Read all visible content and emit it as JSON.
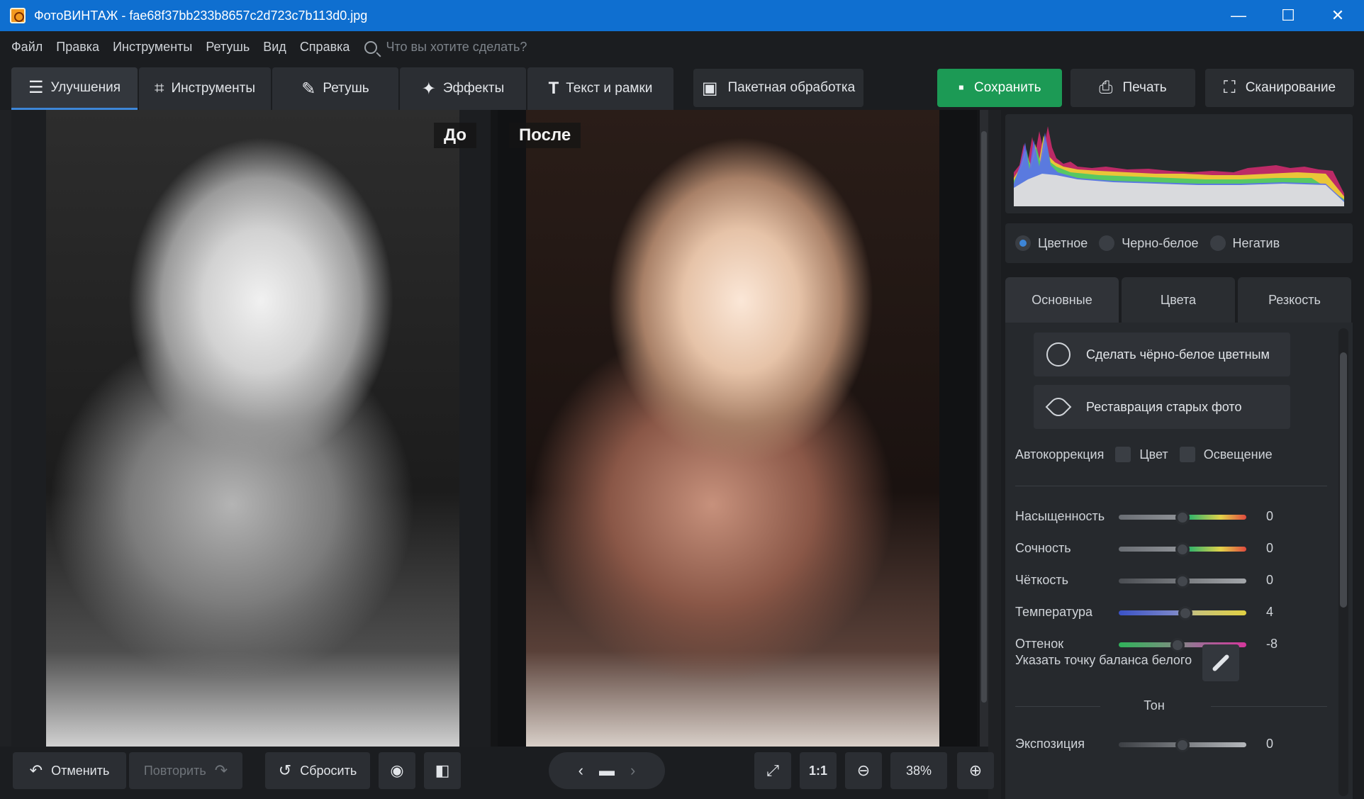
{
  "window": {
    "title": "ФотоВИНТАЖ - fae68f37bb233b8657c2d723c7b113d0.jpg",
    "minimize": "—",
    "maximize": "☐",
    "close": "✕"
  },
  "menu": {
    "items": [
      "Файл",
      "Правка",
      "Инструменты",
      "Ретушь",
      "Вид",
      "Справка"
    ],
    "search_placeholder": "Что вы хотите сделать?"
  },
  "tabs": [
    {
      "label": "Улучшения",
      "icon": "sliders-icon",
      "active": true
    },
    {
      "label": "Инструменты",
      "icon": "crop-icon"
    },
    {
      "label": "Ретушь",
      "icon": "brush-icon"
    },
    {
      "label": "Эффекты",
      "icon": "magic-wand-icon"
    },
    {
      "label": "Текст и рамки",
      "icon": "text-icon"
    }
  ],
  "toolbar": {
    "batch_label": "Пакетная обработка",
    "save_label": "Сохранить",
    "print_label": "Печать",
    "scan_label": "Сканирование",
    "save_color": "#1c9a55"
  },
  "canvas": {
    "before_label": "До",
    "after_label": "После"
  },
  "bottombar": {
    "undo_label": "Отменить",
    "redo_label": "Повторить",
    "reset_label": "Сбросить",
    "actual_size_label": "1:1",
    "zoom_value": "38%"
  },
  "panel": {
    "modes": [
      {
        "label": "Цветное",
        "selected": true
      },
      {
        "label": "Черно-белое",
        "selected": false
      },
      {
        "label": "Негатив",
        "selected": false
      }
    ],
    "tabs": [
      "Основные",
      "Цвета",
      "Резкость"
    ],
    "colorize_label": "Сделать чёрно-белое цветным",
    "restore_label": "Реставрация старых фото",
    "autocorr": {
      "label": "Автокоррекция",
      "color_label": "Цвет",
      "light_label": "Освещение"
    },
    "sliders": [
      {
        "label": "Насыщенность",
        "value": "0",
        "position": 0.5
      },
      {
        "label": "Сочность",
        "value": "0",
        "position": 0.5
      },
      {
        "label": "Чёткость",
        "value": "0",
        "position": 0.5
      },
      {
        "label": "Температура",
        "value": "4",
        "position": 0.52
      },
      {
        "label": "Оттенок",
        "value": "-8",
        "position": 0.46
      }
    ],
    "white_balance_label": "Указать точку баланса белого",
    "tone_title": "Тон",
    "exposure": {
      "label": "Экспозиция",
      "value": "0",
      "position": 0.5
    }
  },
  "accent_color": "#3d86d8"
}
